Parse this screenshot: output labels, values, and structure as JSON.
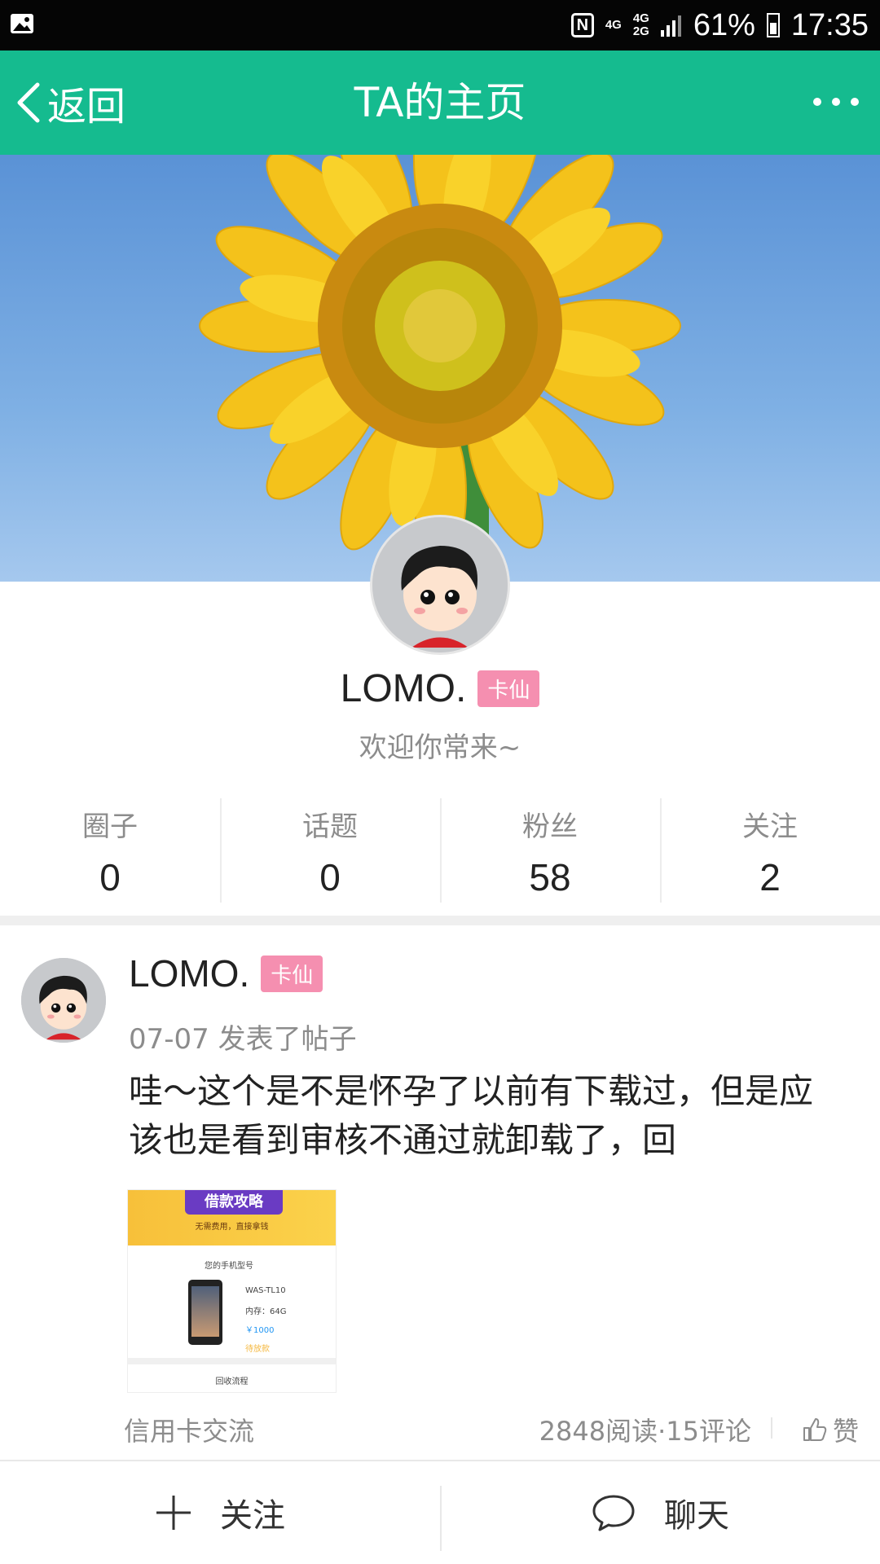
{
  "status_bar": {
    "network_top": "4G",
    "network_mid": "4G",
    "network_bottom": "2G",
    "battery": "61%",
    "time": "17:35",
    "nfc": "N"
  },
  "header": {
    "back_label": "返回",
    "title": "TA的主页"
  },
  "profile": {
    "name": "LOMO.",
    "badge": "卡仙",
    "welcome": "欢迎你常来~",
    "stats": [
      {
        "label": "圈子",
        "value": "0"
      },
      {
        "label": "话题",
        "value": "0"
      },
      {
        "label": "粉丝",
        "value": "58"
      },
      {
        "label": "关注",
        "value": "2"
      }
    ]
  },
  "post": {
    "author": "LOMO.",
    "badge": "卡仙",
    "meta": "07-07 发表了帖子",
    "text": "哇～这个是不是怀孕了以前有下载过，但是应该也是看到审核不通过就卸载了，回",
    "image": {
      "banner_title": "借款攻略",
      "banner_sub": "无需费用，直接拿钱",
      "model_label": "您的手机型号",
      "model": "WAS-TL10",
      "memory": "内存：64G",
      "price": "￥1000",
      "status": "待放款",
      "process": "回收流程"
    },
    "tag": "信用卡交流",
    "stats": "2848阅读·15评论",
    "like_label": "赞"
  },
  "bottom_bar": {
    "follow_label": "关注",
    "chat_label": "聊天"
  },
  "colors": {
    "accent": "#15bb8f",
    "badge": "#f58fb0"
  }
}
